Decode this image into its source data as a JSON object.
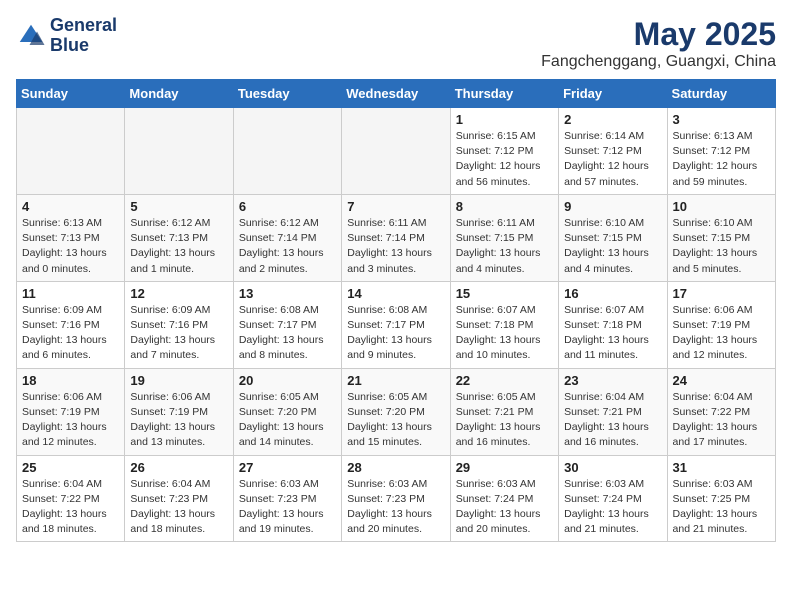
{
  "header": {
    "logo_line1": "General",
    "logo_line2": "Blue",
    "month_title": "May 2025",
    "location": "Fangchenggang, Guangxi, China"
  },
  "weekdays": [
    "Sunday",
    "Monday",
    "Tuesday",
    "Wednesday",
    "Thursday",
    "Friday",
    "Saturday"
  ],
  "weeks": [
    [
      {
        "day": "",
        "info": ""
      },
      {
        "day": "",
        "info": ""
      },
      {
        "day": "",
        "info": ""
      },
      {
        "day": "",
        "info": ""
      },
      {
        "day": "1",
        "info": "Sunrise: 6:15 AM\nSunset: 7:12 PM\nDaylight: 12 hours\nand 56 minutes."
      },
      {
        "day": "2",
        "info": "Sunrise: 6:14 AM\nSunset: 7:12 PM\nDaylight: 12 hours\nand 57 minutes."
      },
      {
        "day": "3",
        "info": "Sunrise: 6:13 AM\nSunset: 7:12 PM\nDaylight: 12 hours\nand 59 minutes."
      }
    ],
    [
      {
        "day": "4",
        "info": "Sunrise: 6:13 AM\nSunset: 7:13 PM\nDaylight: 13 hours\nand 0 minutes."
      },
      {
        "day": "5",
        "info": "Sunrise: 6:12 AM\nSunset: 7:13 PM\nDaylight: 13 hours\nand 1 minute."
      },
      {
        "day": "6",
        "info": "Sunrise: 6:12 AM\nSunset: 7:14 PM\nDaylight: 13 hours\nand 2 minutes."
      },
      {
        "day": "7",
        "info": "Sunrise: 6:11 AM\nSunset: 7:14 PM\nDaylight: 13 hours\nand 3 minutes."
      },
      {
        "day": "8",
        "info": "Sunrise: 6:11 AM\nSunset: 7:15 PM\nDaylight: 13 hours\nand 4 minutes."
      },
      {
        "day": "9",
        "info": "Sunrise: 6:10 AM\nSunset: 7:15 PM\nDaylight: 13 hours\nand 4 minutes."
      },
      {
        "day": "10",
        "info": "Sunrise: 6:10 AM\nSunset: 7:15 PM\nDaylight: 13 hours\nand 5 minutes."
      }
    ],
    [
      {
        "day": "11",
        "info": "Sunrise: 6:09 AM\nSunset: 7:16 PM\nDaylight: 13 hours\nand 6 minutes."
      },
      {
        "day": "12",
        "info": "Sunrise: 6:09 AM\nSunset: 7:16 PM\nDaylight: 13 hours\nand 7 minutes."
      },
      {
        "day": "13",
        "info": "Sunrise: 6:08 AM\nSunset: 7:17 PM\nDaylight: 13 hours\nand 8 minutes."
      },
      {
        "day": "14",
        "info": "Sunrise: 6:08 AM\nSunset: 7:17 PM\nDaylight: 13 hours\nand 9 minutes."
      },
      {
        "day": "15",
        "info": "Sunrise: 6:07 AM\nSunset: 7:18 PM\nDaylight: 13 hours\nand 10 minutes."
      },
      {
        "day": "16",
        "info": "Sunrise: 6:07 AM\nSunset: 7:18 PM\nDaylight: 13 hours\nand 11 minutes."
      },
      {
        "day": "17",
        "info": "Sunrise: 6:06 AM\nSunset: 7:19 PM\nDaylight: 13 hours\nand 12 minutes."
      }
    ],
    [
      {
        "day": "18",
        "info": "Sunrise: 6:06 AM\nSunset: 7:19 PM\nDaylight: 13 hours\nand 12 minutes."
      },
      {
        "day": "19",
        "info": "Sunrise: 6:06 AM\nSunset: 7:19 PM\nDaylight: 13 hours\nand 13 minutes."
      },
      {
        "day": "20",
        "info": "Sunrise: 6:05 AM\nSunset: 7:20 PM\nDaylight: 13 hours\nand 14 minutes."
      },
      {
        "day": "21",
        "info": "Sunrise: 6:05 AM\nSunset: 7:20 PM\nDaylight: 13 hours\nand 15 minutes."
      },
      {
        "day": "22",
        "info": "Sunrise: 6:05 AM\nSunset: 7:21 PM\nDaylight: 13 hours\nand 16 minutes."
      },
      {
        "day": "23",
        "info": "Sunrise: 6:04 AM\nSunset: 7:21 PM\nDaylight: 13 hours\nand 16 minutes."
      },
      {
        "day": "24",
        "info": "Sunrise: 6:04 AM\nSunset: 7:22 PM\nDaylight: 13 hours\nand 17 minutes."
      }
    ],
    [
      {
        "day": "25",
        "info": "Sunrise: 6:04 AM\nSunset: 7:22 PM\nDaylight: 13 hours\nand 18 minutes."
      },
      {
        "day": "26",
        "info": "Sunrise: 6:04 AM\nSunset: 7:23 PM\nDaylight: 13 hours\nand 18 minutes."
      },
      {
        "day": "27",
        "info": "Sunrise: 6:03 AM\nSunset: 7:23 PM\nDaylight: 13 hours\nand 19 minutes."
      },
      {
        "day": "28",
        "info": "Sunrise: 6:03 AM\nSunset: 7:23 PM\nDaylight: 13 hours\nand 20 minutes."
      },
      {
        "day": "29",
        "info": "Sunrise: 6:03 AM\nSunset: 7:24 PM\nDaylight: 13 hours\nand 20 minutes."
      },
      {
        "day": "30",
        "info": "Sunrise: 6:03 AM\nSunset: 7:24 PM\nDaylight: 13 hours\nand 21 minutes."
      },
      {
        "day": "31",
        "info": "Sunrise: 6:03 AM\nSunset: 7:25 PM\nDaylight: 13 hours\nand 21 minutes."
      }
    ]
  ]
}
